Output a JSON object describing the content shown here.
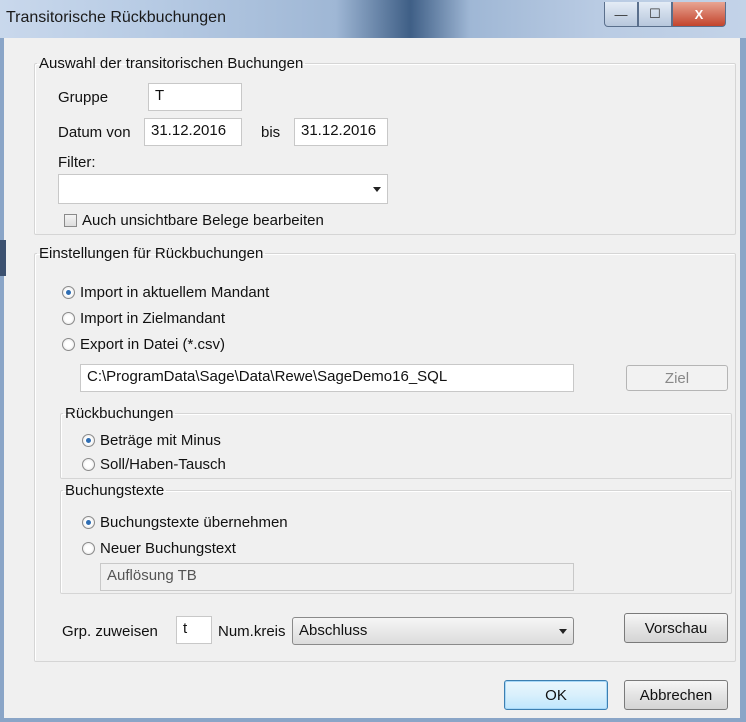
{
  "window": {
    "title": "Transitorische Rückbuchungen",
    "controls": {
      "minimize": "—",
      "maximize": "☐",
      "close": "X"
    }
  },
  "auswahl": {
    "legend": "Auswahl der transitorischen Buchungen",
    "gruppe_label": "Gruppe",
    "gruppe_value": "T",
    "datum_von_label": "Datum von",
    "datum_von_value": "31.12.2016",
    "bis_label": "bis",
    "bis_value": "31.12.2016",
    "filter_label": "Filter:",
    "filter_value": "",
    "unsichtbar_label": "Auch unsichtbare Belege bearbeiten",
    "unsichtbar_checked": false
  },
  "einstellungen": {
    "legend": "Einstellungen für Rückbuchungen",
    "options": [
      {
        "label": "Import in aktuellem Mandant",
        "selected": true
      },
      {
        "label": "Import in Zielmandant",
        "selected": false
      },
      {
        "label": "Export in Datei (*.csv)",
        "selected": false
      }
    ],
    "path_value": "C:\\ProgramData\\Sage\\Data\\Rewe\\SageDemo16_SQL",
    "ziel_button": "Ziel"
  },
  "rueckbuchungen": {
    "legend": "Rückbuchungen",
    "options": [
      {
        "label": "Beträge mit Minus",
        "selected": true
      },
      {
        "label": "Soll/Haben-Tausch",
        "selected": false
      }
    ]
  },
  "buchungstexte": {
    "legend": "Buchungstexte",
    "options": [
      {
        "label": "Buchungstexte übernehmen",
        "selected": true
      },
      {
        "label": "Neuer Buchungstext",
        "selected": false
      }
    ],
    "text_value": "Auflösung TB"
  },
  "bottom": {
    "grp_label": "Grp. zuweisen",
    "grp_value": "t",
    "numkreis_label": "Num.kreis",
    "numkreis_value": "Abschluss",
    "vorschau_button": "Vorschau"
  },
  "footer": {
    "ok_button": "OK",
    "cancel_button": "Abbrechen"
  },
  "colors": {
    "titlebar": "#b7cbe4",
    "window_bg": "#f0f0f0",
    "radio_selected": "#2e6db3"
  }
}
